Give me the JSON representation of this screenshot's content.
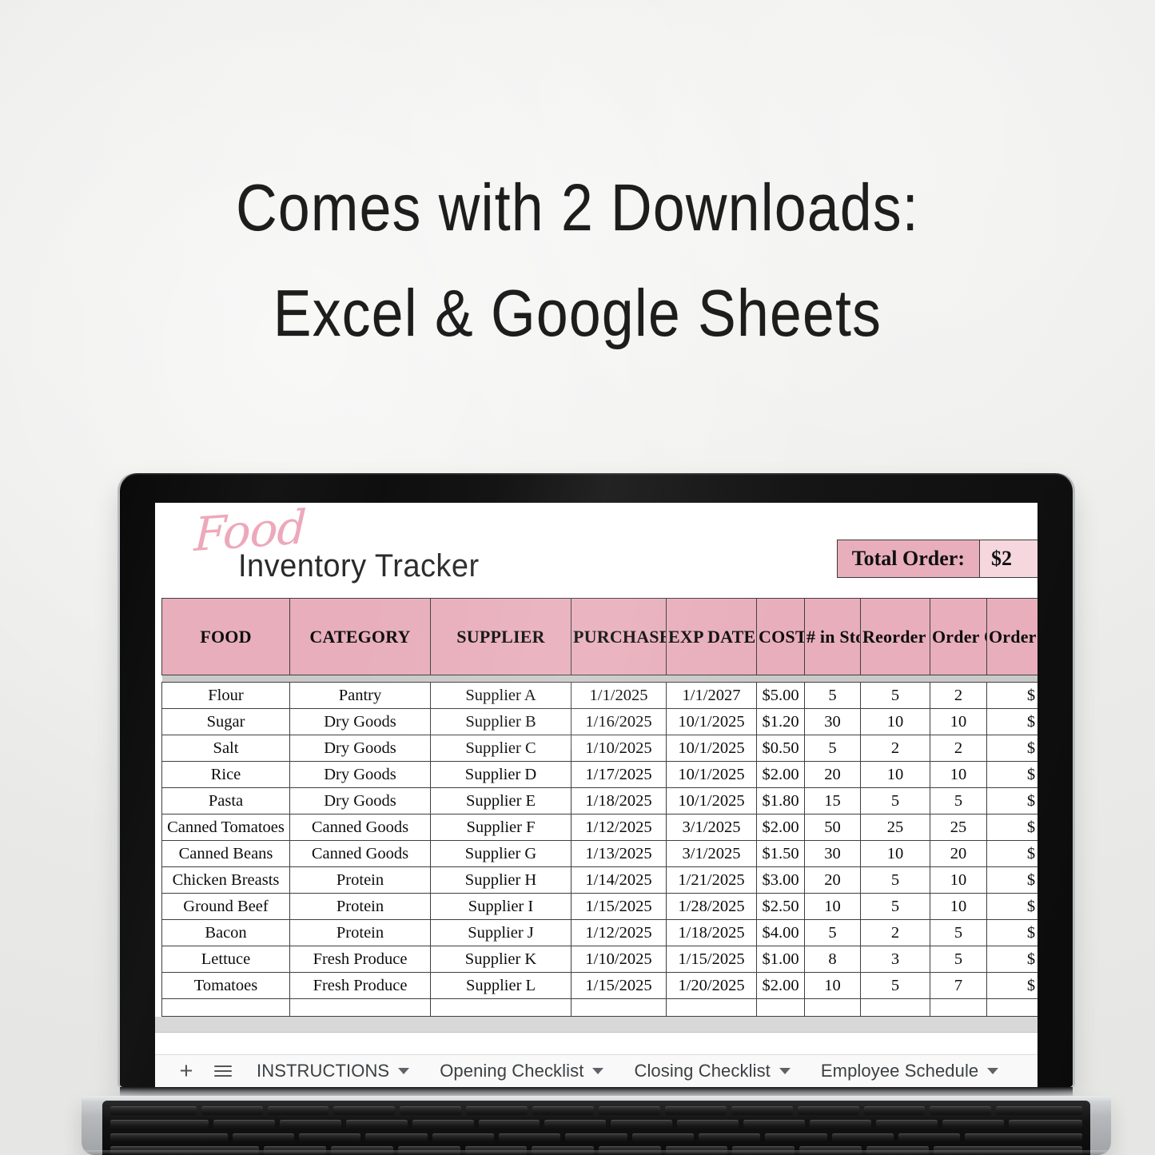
{
  "headline": {
    "line1": "Comes with 2 Downloads:",
    "line2": "Excel & Google Sheets"
  },
  "spreadsheet": {
    "brand_script": "Food",
    "brand_subtitle": "Inventory Tracker",
    "total_order_label": "Total Order:",
    "total_order_value": "$2",
    "accent_pink": "#e8aebb",
    "accent_pink_light": "#f6d7de",
    "script_pink": "#eda8bb",
    "columns": [
      "FOOD",
      "CATEGORY",
      "SUPPLIER",
      "PURCHASE DATE",
      "EXP DATE",
      "COST Per Item",
      "# in Stock",
      "Reorder Level",
      "Order Qty",
      "Order Price"
    ],
    "rows": [
      {
        "food": "Flour",
        "category": "Pantry",
        "supplier": "Supplier A",
        "purchase_date": "1/1/2025",
        "exp_date": "1/1/2027",
        "cost": "$5.00",
        "stock": "5",
        "reorder": "5",
        "qty": "2",
        "price": "$"
      },
      {
        "food": "Sugar",
        "category": "Dry Goods",
        "supplier": "Supplier B",
        "purchase_date": "1/16/2025",
        "exp_date": "10/1/2025",
        "cost": "$1.20",
        "stock": "30",
        "reorder": "10",
        "qty": "10",
        "price": "$"
      },
      {
        "food": "Salt",
        "category": "Dry Goods",
        "supplier": "Supplier C",
        "purchase_date": "1/10/2025",
        "exp_date": "10/1/2025",
        "cost": "$0.50",
        "stock": "5",
        "reorder": "2",
        "qty": "2",
        "price": "$"
      },
      {
        "food": "Rice",
        "category": "Dry Goods",
        "supplier": "Supplier D",
        "purchase_date": "1/17/2025",
        "exp_date": "10/1/2025",
        "cost": "$2.00",
        "stock": "20",
        "reorder": "10",
        "qty": "10",
        "price": "$"
      },
      {
        "food": "Pasta",
        "category": "Dry Goods",
        "supplier": "Supplier E",
        "purchase_date": "1/18/2025",
        "exp_date": "10/1/2025",
        "cost": "$1.80",
        "stock": "15",
        "reorder": "5",
        "qty": "5",
        "price": "$"
      },
      {
        "food": "Canned Tomatoes",
        "category": "Canned Goods",
        "supplier": "Supplier F",
        "purchase_date": "1/12/2025",
        "exp_date": "3/1/2025",
        "cost": "$2.00",
        "stock": "50",
        "reorder": "25",
        "qty": "25",
        "price": "$"
      },
      {
        "food": "Canned Beans",
        "category": "Canned Goods",
        "supplier": "Supplier G",
        "purchase_date": "1/13/2025",
        "exp_date": "3/1/2025",
        "cost": "$1.50",
        "stock": "30",
        "reorder": "10",
        "qty": "20",
        "price": "$"
      },
      {
        "food": "Chicken Breasts",
        "category": "Protein",
        "supplier": "Supplier H",
        "purchase_date": "1/14/2025",
        "exp_date": "1/21/2025",
        "cost": "$3.00",
        "stock": "20",
        "reorder": "5",
        "qty": "10",
        "price": "$"
      },
      {
        "food": "Ground Beef",
        "category": "Protein",
        "supplier": "Supplier I",
        "purchase_date": "1/15/2025",
        "exp_date": "1/28/2025",
        "cost": "$2.50",
        "stock": "10",
        "reorder": "5",
        "qty": "10",
        "price": "$"
      },
      {
        "food": "Bacon",
        "category": "Protein",
        "supplier": "Supplier J",
        "purchase_date": "1/12/2025",
        "exp_date": "1/18/2025",
        "cost": "$4.00",
        "stock": "5",
        "reorder": "2",
        "qty": "5",
        "price": "$"
      },
      {
        "food": "Lettuce",
        "category": "Fresh Produce",
        "supplier": "Supplier K",
        "purchase_date": "1/10/2025",
        "exp_date": "1/15/2025",
        "cost": "$1.00",
        "stock": "8",
        "reorder": "3",
        "qty": "5",
        "price": "$"
      },
      {
        "food": "Tomatoes",
        "category": "Fresh Produce",
        "supplier": "Supplier L",
        "purchase_date": "1/15/2025",
        "exp_date": "1/20/2025",
        "cost": "$2.00",
        "stock": "10",
        "reorder": "5",
        "qty": "7",
        "price": "$"
      }
    ]
  },
  "tabbar": {
    "add_sheet_icon": "plus-icon",
    "all_sheets_icon": "hamburger-menu-icon",
    "tabs": [
      {
        "label": "INSTRUCTIONS",
        "caret": "chevron-down-icon"
      },
      {
        "label": "Opening Checklist",
        "caret": "chevron-down-icon"
      },
      {
        "label": "Closing Checklist",
        "caret": "chevron-down-icon"
      },
      {
        "label": "Employee Schedule",
        "caret": "chevron-down-icon"
      }
    ]
  }
}
